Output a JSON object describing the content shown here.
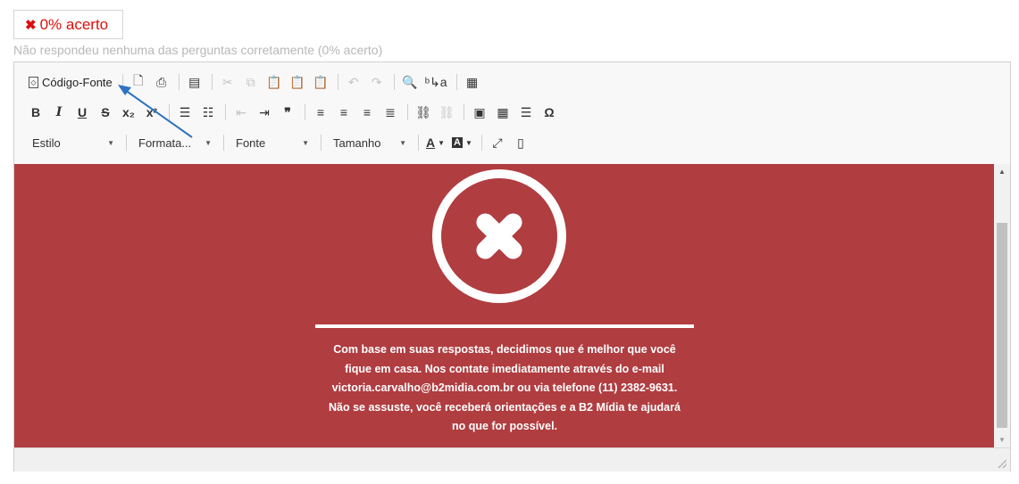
{
  "result": {
    "badge_icon": "✖",
    "badge_label": "0% acerto",
    "subtitle": "Não respondeu nenhuma das perguntas corretamente (0% acerto)",
    "accent_color": "#e00d0d"
  },
  "toolbar": {
    "source_label": "Código-Fonte",
    "row2": {
      "bold": "B",
      "italic": "I",
      "underline": "U",
      "strike": "S",
      "subscript": "x₂",
      "superscript": "x²",
      "blockquote": "❞",
      "special_char": "Ω"
    },
    "combos": {
      "estilo": "Estilo",
      "formatacao": "Formata...",
      "fonte": "Fonte",
      "tamanho": "Tamanho"
    },
    "text_color": "A",
    "bg_color": "A"
  },
  "content": {
    "background_color": "#b03d40",
    "message_lines": [
      "Com base em suas respostas, decidimos que é melhor que você",
      "fique em casa. Nos contate imediatamente através do e-mail",
      "victoria.carvalho@b2midia.com.br ou via telefone (11) 2382-9631.",
      "Não se assuste, você receberá orientações e a B2 Mídia te ajudará",
      "no que for possível."
    ]
  }
}
